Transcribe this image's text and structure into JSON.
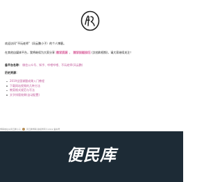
{
  "intro": {
    "welcome": "欢迎访问“不玩老师”（风云鹏小子）的个人博客。",
    "line2_a": "在其他自媒体平台，我将继续为大家分享",
    "line2_link1": "教学资源",
    "line2_sep": "、",
    "line2_link2": "教学技能技巧",
    "line2_b": "(文档和视频)，请大家继续关注！"
  },
  "backup": {
    "label": "备平台名称：",
    "value": "微信公众号、知乎、哔哩哔哩、不玩老师(风云鹏)"
  },
  "history": {
    "label": "历史资源：",
    "items": [
      "2019全国课题成果入门教程",
      "下载网站视频的几种方法",
      "教案格式规范与写法",
      "文字排版效果(自动配置)"
    ]
  },
  "footer": {
    "text_left": "博客地址@风云鹏小子",
    "text_right": "风云鹏博客 版权所有©2019 备案号"
  },
  "brand": {
    "name": "便民库"
  },
  "colors": {
    "link": "#c0589a",
    "highlight_bg": "#f8d7ea",
    "dark_bg": "#1d2b36"
  }
}
